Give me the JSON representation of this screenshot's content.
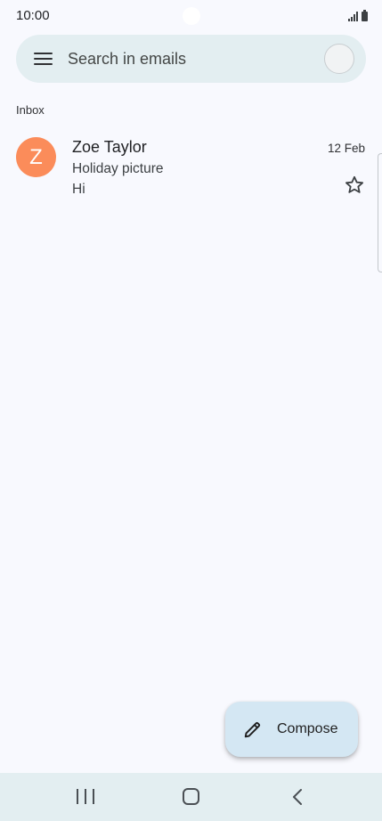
{
  "status_bar": {
    "time": "10:00"
  },
  "search": {
    "placeholder": "Search in emails"
  },
  "inbox": {
    "label": "Inbox"
  },
  "emails": [
    {
      "avatar_letter": "Z",
      "avatar_color": "#fb8c5a",
      "sender": "Zoe Taylor",
      "date": "12 Feb",
      "subject": "Holiday picture",
      "snippet": "Hi",
      "starred": false
    }
  ],
  "compose": {
    "label": "Compose"
  },
  "icons": {
    "menu": "menu-icon",
    "account": "account-avatar",
    "star": "star-outline-icon",
    "compose": "pencil-icon",
    "nav_recent": "recent-apps-icon",
    "nav_home": "home-icon",
    "nav_back": "back-icon"
  },
  "colors": {
    "background": "#f8f9fe",
    "search_bar": "#e3eef1",
    "compose_fab": "#d4e7f3"
  }
}
